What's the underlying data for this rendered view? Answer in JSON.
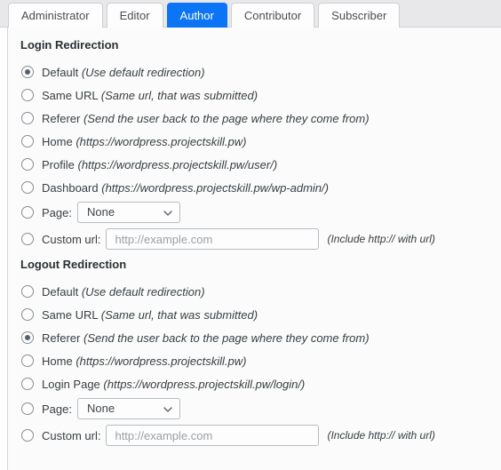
{
  "tabs": [
    {
      "label": "Administrator",
      "active": false
    },
    {
      "label": "Editor",
      "active": false
    },
    {
      "label": "Author",
      "active": true
    },
    {
      "label": "Contributor",
      "active": false
    },
    {
      "label": "Subscriber",
      "active": false
    }
  ],
  "colors": {
    "active_tab_bg": "#0b75f5",
    "active_tab_text": "#ffffff",
    "tabstrip_bg": "#e8e8ea",
    "panel_bg": "#fafbfa",
    "text": "#3b4045",
    "placeholder": "#9aa0a6"
  },
  "login": {
    "title": "Login Redirection",
    "options": [
      {
        "name": "default",
        "label": "Default",
        "hint": "(Use default redirection)",
        "selected": true
      },
      {
        "name": "same-url",
        "label": "Same URL",
        "hint": "(Same url, that was submitted)",
        "selected": false
      },
      {
        "name": "referer",
        "label": "Referer",
        "hint": "(Send the user back to the page where they come from)",
        "selected": false
      },
      {
        "name": "home",
        "label": "Home",
        "hint": "(https://wordpress.projectskill.pw)",
        "selected": false
      },
      {
        "name": "profile",
        "label": "Profile",
        "hint": "(https://wordpress.projectskill.pw/user/)",
        "selected": false
      },
      {
        "name": "dashboard",
        "label": "Dashboard",
        "hint": "(https://wordpress.projectskill.pw/wp-admin/)",
        "selected": false
      }
    ],
    "page": {
      "label": "Page:",
      "selected": "None",
      "selected_value": "None",
      "options": [
        "None"
      ],
      "checked": false
    },
    "custom": {
      "label": "Custom url:",
      "value": "",
      "placeholder": "http://example.com",
      "hint": "(Include http:// with url)",
      "checked": false
    }
  },
  "logout": {
    "title": "Logout Redirection",
    "options": [
      {
        "name": "default",
        "label": "Default",
        "hint": "(Use default redirection)",
        "selected": false
      },
      {
        "name": "same-url",
        "label": "Same URL",
        "hint": "(Same url, that was submitted)",
        "selected": false
      },
      {
        "name": "referer",
        "label": "Referer",
        "hint": "(Send the user back to the page where they come from)",
        "selected": true
      },
      {
        "name": "home",
        "label": "Home",
        "hint": "(https://wordpress.projectskill.pw)",
        "selected": false
      },
      {
        "name": "login-page",
        "label": "Login Page",
        "hint": "(https://wordpress.projectskill.pw/login/)",
        "selected": false
      }
    ],
    "page": {
      "label": "Page:",
      "selected": "None",
      "selected_value": "None",
      "options": [
        "None"
      ],
      "checked": false
    },
    "custom": {
      "label": "Custom url:",
      "value": "",
      "placeholder": "http://example.com",
      "hint": "(Include http:// with url)",
      "checked": false
    }
  }
}
